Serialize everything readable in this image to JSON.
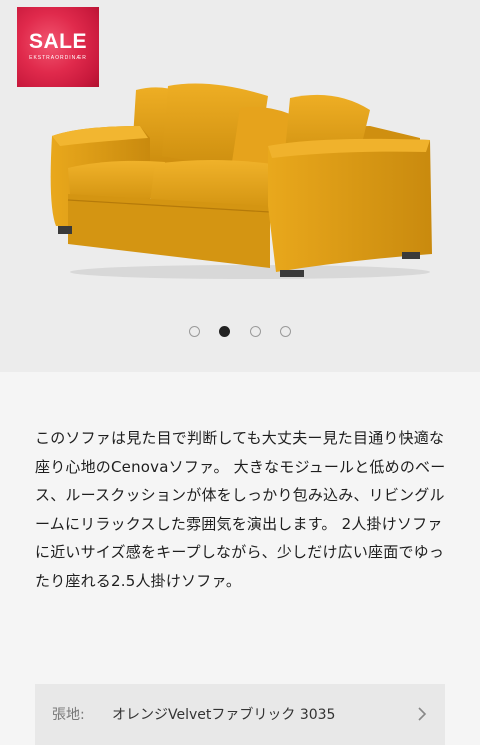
{
  "gallery": {
    "badge": {
      "label": "SALE",
      "sub_label": "EKSTRAORDINÆR"
    },
    "product_image_alt": "sofa",
    "dots": [
      {
        "active": false
      },
      {
        "active": true
      },
      {
        "active": false
      },
      {
        "active": false
      }
    ]
  },
  "description": {
    "text": "このソファは見た目で判断しても大丈夫ー見た目通り快適な座り心地のCenovaソファ。 大きなモジュールと低めのベース、ルースクッションが体をしっかり包み込み、リビングルームにリラックスした雰囲気を演出します。 2人掛けソファに近いサイズ感をキープしながら、少しだけ広い座面でゆったり座れる2.5人掛けソファ。"
  },
  "fabric": {
    "label": "張地:",
    "value": "オレンジVelvetファブリック 3035"
  },
  "colors": {
    "sofa_main": "#e2a01a",
    "sofa_shadow": "#b77a0c",
    "sale_red": "#e02a4c"
  }
}
